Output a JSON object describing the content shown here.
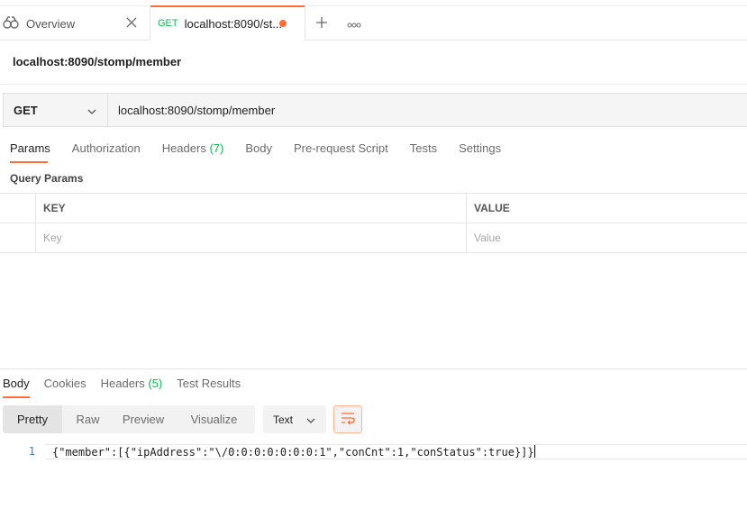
{
  "tabs": {
    "overview_label": "Overview",
    "request_method": "GET",
    "request_label": "localhost:8090/st..."
  },
  "request": {
    "title": "localhost:8090/stomp/member",
    "method": "GET",
    "url": "localhost:8090/stomp/member"
  },
  "request_tabs": {
    "params": "Params",
    "authorization": "Authorization",
    "headers": "Headers",
    "headers_count": "(7)",
    "body": "Body",
    "prerequest": "Pre-request Script",
    "tests": "Tests",
    "settings": "Settings"
  },
  "query_params": {
    "title": "Query Params",
    "col_key": "KEY",
    "col_value": "VALUE",
    "key_placeholder": "Key",
    "value_placeholder": "Value"
  },
  "response_tabs": {
    "body": "Body",
    "cookies": "Cookies",
    "headers": "Headers",
    "headers_count": "(5)",
    "test_results": "Test Results"
  },
  "view_modes": {
    "pretty": "Pretty",
    "raw": "Raw",
    "preview": "Preview",
    "visualize": "Visualize",
    "format": "Text"
  },
  "response_body": {
    "line_number": "1",
    "code": "{\"member\":[{\"ipAddress\":\"\\/0:0:0:0:0:0:0:1\",\"conCnt\":1,\"conStatus\":true}]}"
  },
  "colors": {
    "accent": "#ff6c37",
    "get_method": "#0cbb52"
  }
}
